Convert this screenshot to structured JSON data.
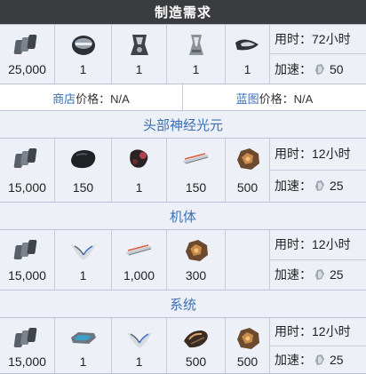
{
  "header": {
    "title": "制造需求"
  },
  "main_recipe": {
    "items": [
      {
        "icon": "credits-icon",
        "qty": "25,000"
      },
      {
        "icon": "helmet-blueprint-icon",
        "qty": "1"
      },
      {
        "icon": "chassis-blueprint-icon",
        "qty": "1"
      },
      {
        "icon": "systems-blueprint-icon",
        "qty": "1"
      },
      {
        "icon": "neural-part-icon",
        "qty": "1"
      }
    ],
    "time_label": "用时：",
    "time_value": "72小时",
    "rush_label": "加速：",
    "rush_value": "50"
  },
  "prices": {
    "shop_link": "商店",
    "shop_text": "价格：N/A",
    "blueprint_link": "蓝图",
    "blueprint_text": "价格：N/A"
  },
  "sections": [
    {
      "title": "头部神经光元",
      "items": [
        {
          "icon": "credits-icon",
          "qty": "15,000"
        },
        {
          "icon": "black-stone-icon",
          "qty": "150"
        },
        {
          "icon": "organic-part-icon",
          "qty": "1"
        },
        {
          "icon": "rubedo-icon",
          "qty": "150"
        },
        {
          "icon": "ferrite-icon",
          "qty": "500"
        }
      ],
      "time_label": "用时：",
      "time_value": "12小时",
      "rush_label": "加速：",
      "rush_value": "25"
    },
    {
      "title": "机体",
      "items": [
        {
          "icon": "credits-icon",
          "qty": "15,000"
        },
        {
          "icon": "morphics-icon",
          "qty": "1"
        },
        {
          "icon": "rubedo-icon",
          "qty": "1,000"
        },
        {
          "icon": "ferrite-icon",
          "qty": "300"
        }
      ],
      "time_label": "用时：",
      "time_value": "12小时",
      "rush_label": "加速：",
      "rush_value": "25"
    },
    {
      "title": "系统",
      "items": [
        {
          "icon": "credits-icon",
          "qty": "15,000"
        },
        {
          "icon": "circuits-icon",
          "qty": "1"
        },
        {
          "icon": "morphics-icon",
          "qty": "1"
        },
        {
          "icon": "alloy-plate-icon",
          "qty": "500"
        },
        {
          "icon": "ferrite-icon",
          "qty": "500"
        }
      ],
      "time_label": "用时：",
      "time_value": "12小时",
      "rush_label": "加速：",
      "rush_value": "25"
    }
  ],
  "colors": {
    "header_bg": "#3a3c40",
    "link": "#3b6fb6",
    "cell_bg": "#eef0f7"
  }
}
